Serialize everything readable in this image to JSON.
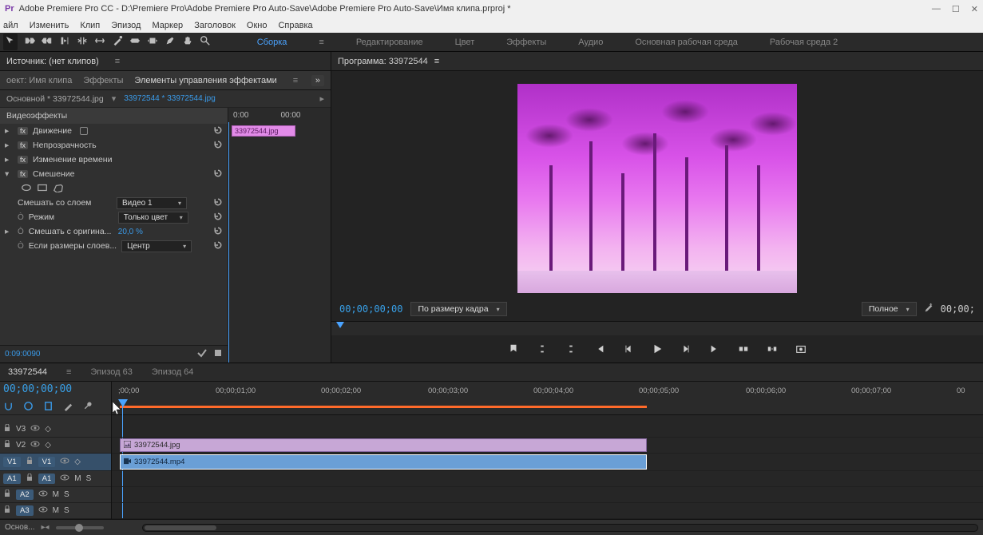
{
  "titlebar": {
    "text": "Adobe Premiere Pro CC - D:\\Premiere Pro\\Adobe Premiere Pro Auto-Save\\Adobe Premiere Pro Auto-Save\\Имя клипа.prproj *"
  },
  "menu": {
    "file": "айл",
    "edit": "Изменить",
    "clip": "Клип",
    "episode": "Эпизод",
    "marker": "Маркер",
    "title": "Заголовок",
    "window": "Окно",
    "help": "Справка"
  },
  "workspaces": {
    "w1": "Сборка",
    "w2": "Редактирование",
    "w3": "Цвет",
    "w4": "Эффекты",
    "w5": "Аудио",
    "w6": "Основная рабочая среда",
    "w7": "Рабочая среда 2"
  },
  "source_panel": {
    "label": "Источник: (нет клипов)"
  },
  "left_tabs": {
    "t1": "оект: Имя клипа",
    "t2": "Эффекты",
    "t3": "Элементы управления эффектами"
  },
  "effect_header": {
    "master": "Основной * 33972544.jpg",
    "link": "33972544 * 33972544.jpg"
  },
  "mini": {
    "t0": "0:00",
    "t1": "00:00",
    "clip": "33972544.jpg"
  },
  "fx": {
    "section": "Видеоэффекты",
    "motion": "Движение",
    "opacity": "Непрозрачность",
    "timeremap": "Изменение времени",
    "blend": "Смешение",
    "blend_with_layer": "Смешать со слоем",
    "blend_with_layer_val": "Видео 1",
    "mode": "Режим",
    "mode_val": "Только цвет",
    "blend_original": "Смешать с оригина...",
    "blend_original_val": "20,0 %",
    "layer_sizes": "Если размеры слоев...",
    "layer_sizes_val": "Центр"
  },
  "eff_foot_tc": "0:09:0090",
  "program": {
    "tab": "Программа: 33972544",
    "tc_left": "00;00;00;00",
    "fit": "По размеру кадра",
    "quality": "Полное",
    "tc_right": "00;00;"
  },
  "timeline": {
    "tabs": {
      "t1": "33972544",
      "t2": "Эпизод 63",
      "t3": "Эпизод 64"
    },
    "tc": "00;00;00;00",
    "ruler": {
      "r0": ";00;00",
      "r1": "00;00;01;00",
      "r2": "00;00;02;00",
      "r3": "00;00;03;00",
      "r4": "00;00;04;00",
      "r5": "00;00;05;00",
      "r6": "00;00;06;00",
      "r7": "00;00;07;00",
      "r8": "00"
    },
    "tracks": {
      "v3": "V3",
      "v2": "V2",
      "v1l": "V1",
      "v1": "V1",
      "a1l": "A1",
      "a1": "A1",
      "a2": "A2",
      "a3": "A3",
      "m": "M",
      "s": "S"
    },
    "clips": {
      "c1": "33972544.jpg",
      "c2": "33972544.mp4"
    },
    "footer": "Основ..."
  }
}
